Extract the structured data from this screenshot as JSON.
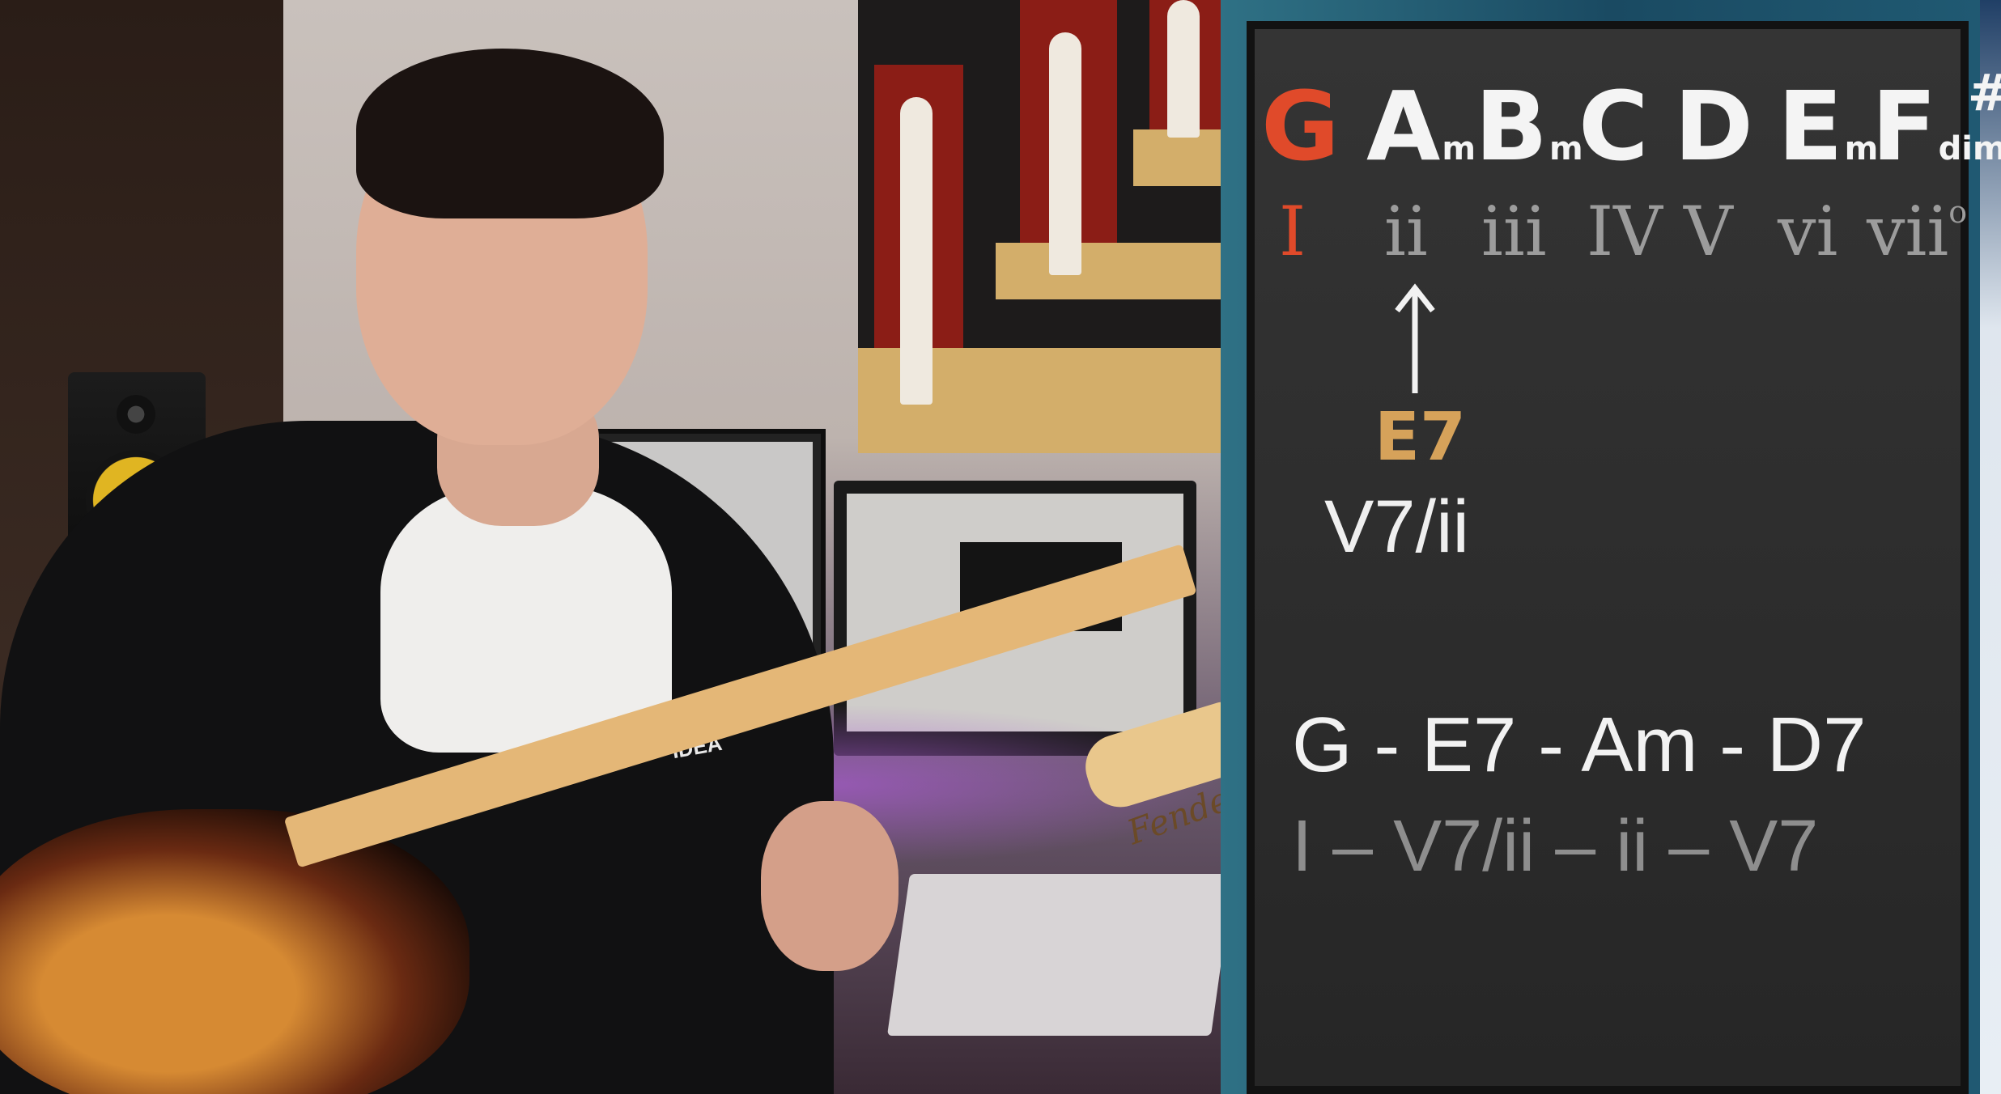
{
  "scene": {
    "hoodie_logo": "IDEA",
    "headstock_logo": "Fender"
  },
  "board": {
    "chords": [
      {
        "root": "G",
        "quality": "",
        "sharp": "",
        "active": true
      },
      {
        "root": "A",
        "quality": "m",
        "sharp": "",
        "active": false
      },
      {
        "root": "B",
        "quality": "m",
        "sharp": "",
        "active": false
      },
      {
        "root": "C",
        "quality": "",
        "sharp": "",
        "active": false
      },
      {
        "root": "D",
        "quality": "",
        "sharp": "",
        "active": false
      },
      {
        "root": "E",
        "quality": "m",
        "sharp": "",
        "active": false
      },
      {
        "root": "F",
        "quality": "dim",
        "sharp": "#",
        "active": false
      }
    ],
    "numerals": [
      {
        "text": "I",
        "degree": "",
        "active": true
      },
      {
        "text": "ii",
        "degree": "",
        "active": false
      },
      {
        "text": "iii",
        "degree": "",
        "active": false
      },
      {
        "text": "IV",
        "degree": "",
        "active": false
      },
      {
        "text": "V",
        "degree": "",
        "active": false
      },
      {
        "text": "vi",
        "degree": "",
        "active": false
      },
      {
        "text": "vii",
        "degree": "o",
        "active": false
      }
    ],
    "secondary_chord": "E7",
    "secondary_function": "V7/ii",
    "progression": "G - E7 - Am - D7",
    "progression_functions": "I – V7/ii – ii – V7",
    "colors": {
      "active": "#e04a2a",
      "secondary_chord": "#d6a25a",
      "numeral": "#9c9c9c",
      "chalk": "#f4f4f4"
    }
  }
}
